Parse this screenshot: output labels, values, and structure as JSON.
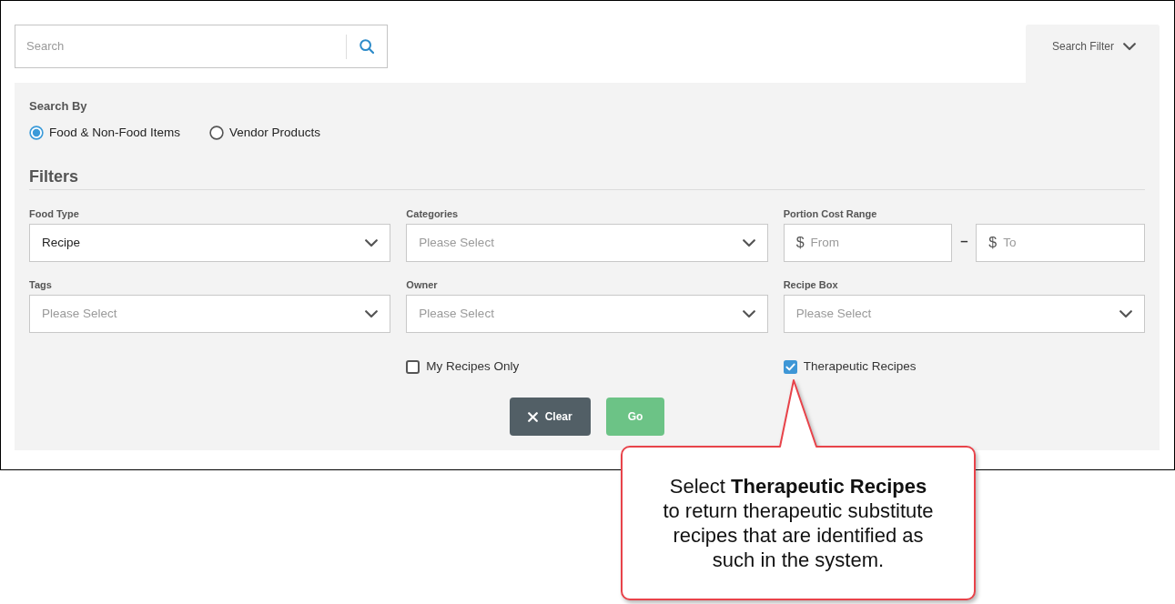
{
  "search": {
    "placeholder": "Search"
  },
  "filter_toggle": {
    "label": "Search Filter",
    "expanded": true
  },
  "search_by": {
    "label": "Search By",
    "options": [
      {
        "label": "Food & Non-Food Items",
        "selected": true
      },
      {
        "label": "Vendor Products",
        "selected": false
      }
    ]
  },
  "filters": {
    "heading": "Filters",
    "fields": [
      {
        "kind": "select",
        "label": "Food Type",
        "value": "Recipe"
      },
      {
        "kind": "select",
        "label": "Categories",
        "placeholder": "Please Select"
      },
      {
        "kind": "range",
        "label": "Portion Cost Range",
        "from": {
          "prefix": "$",
          "placeholder": "From"
        },
        "separator": "–",
        "to": {
          "prefix": "$",
          "placeholder": "To"
        }
      },
      {
        "kind": "select",
        "label": "Tags",
        "placeholder": "Please Select"
      },
      {
        "kind": "select",
        "label": "Owner",
        "placeholder": "Please Select"
      },
      {
        "kind": "select",
        "label": "Recipe Box",
        "placeholder": "Please Select"
      }
    ],
    "checkboxes": [
      {
        "label": "My Recipes Only",
        "checked": false
      },
      {
        "label": "Therapeutic Recipes",
        "checked": true
      }
    ],
    "buttons": [
      {
        "kind": "clear",
        "label": "Clear"
      },
      {
        "kind": "go",
        "label": "Go"
      }
    ]
  },
  "callout": {
    "text": "Select **Therapeutic Recipes**\nto return therapeutic substitute\nrecipes that are identified as\nsuch in the system."
  }
}
